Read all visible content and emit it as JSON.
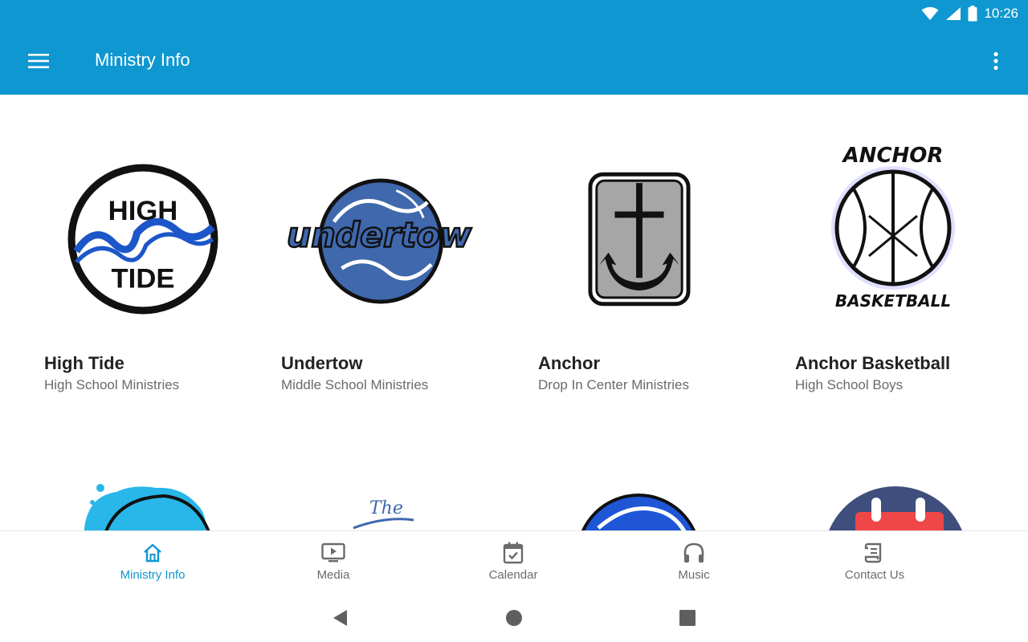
{
  "status_bar": {
    "time": "10:26",
    "icons": [
      "wifi-icon",
      "signal-icon",
      "battery-icon"
    ]
  },
  "app_bar": {
    "title": "Ministry Info",
    "menu_icon": "hamburger-menu-icon",
    "overflow_icon": "more-vert-icon"
  },
  "ministries": [
    {
      "name": "High Tide",
      "subtitle": "High School Ministries",
      "logo_text_top": "HIGH",
      "logo_text_bottom": "TIDE"
    },
    {
      "name": "Undertow",
      "subtitle": "Middle School Ministries",
      "logo_text": "undertow"
    },
    {
      "name": "Anchor",
      "subtitle": "Drop In Center Ministries"
    },
    {
      "name": "Anchor Basketball",
      "subtitle": "High School Boys",
      "logo_text_top": "ANCHOR",
      "logo_text_bottom": "BASKETBALL"
    }
  ],
  "partial_row": {
    "second_logo_text": "The"
  },
  "bottom_nav": {
    "items": [
      {
        "label": "Ministry Info",
        "icon": "home-icon",
        "active": true
      },
      {
        "label": "Media",
        "icon": "video-player-icon",
        "active": false
      },
      {
        "label": "Calendar",
        "icon": "calendar-check-icon",
        "active": false
      },
      {
        "label": "Music",
        "icon": "headphones-icon",
        "active": false
      },
      {
        "label": "Contact Us",
        "icon": "contact-scroll-icon",
        "active": false
      }
    ]
  },
  "system_nav": {
    "buttons": [
      "back-icon",
      "home-circle-icon",
      "recents-icon"
    ]
  },
  "colors": {
    "primary": "#0f97d1",
    "title_text": "#222222",
    "subtitle_text": "#6a6a6a",
    "inactive_nav": "#6b6b6b"
  }
}
